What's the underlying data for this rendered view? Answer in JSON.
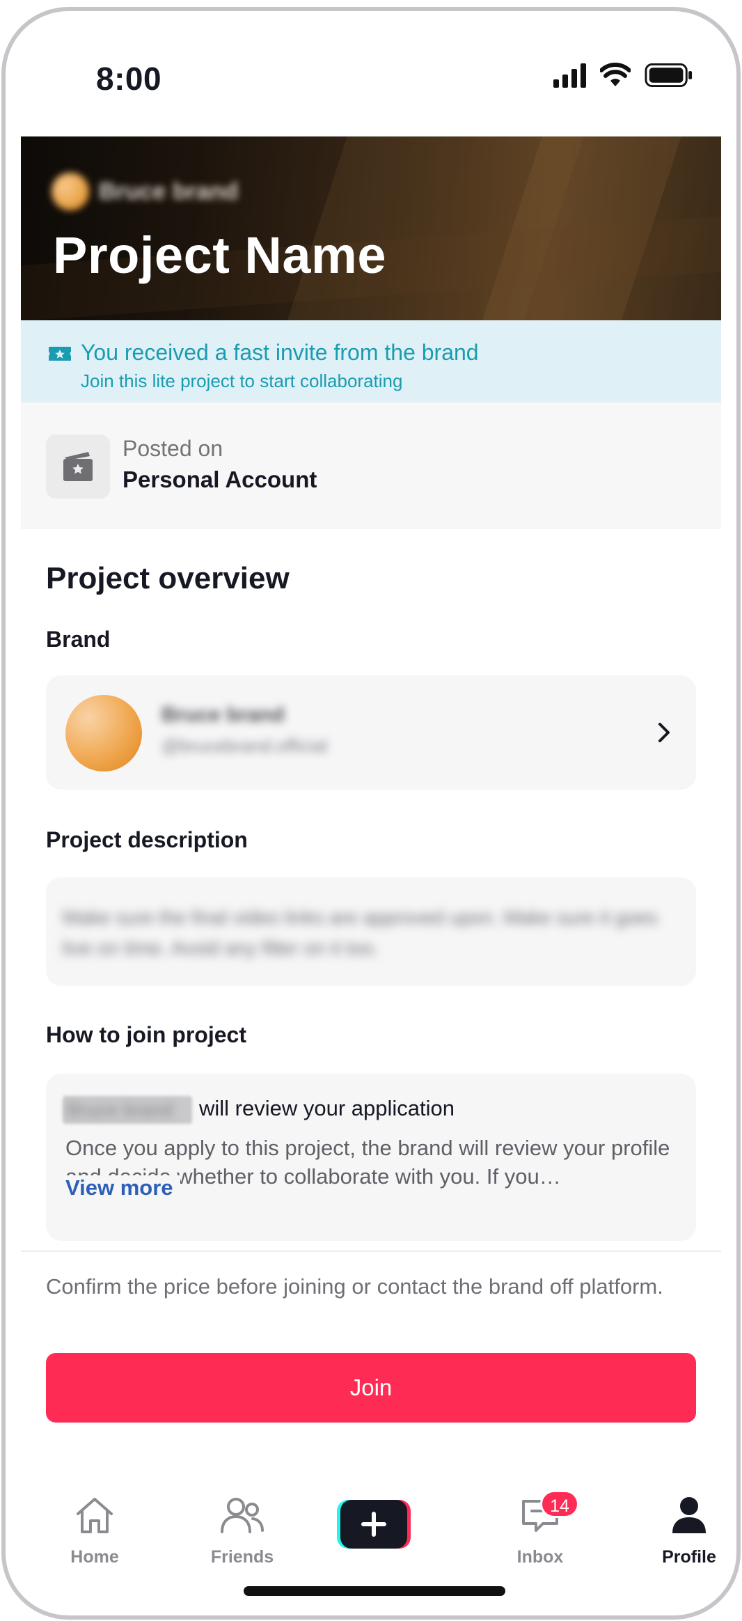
{
  "status_bar": {
    "time": "8:00"
  },
  "header": {
    "brand_name": "Bruce brand",
    "title": "Project Name"
  },
  "invite": {
    "icon": "ticket-icon",
    "title": "You received a fast invite from the brand",
    "subtitle": "Join this lite project to start collaborating",
    "color": "#1a9cb0"
  },
  "posted": {
    "label": "Posted on",
    "account": "Personal Account",
    "icon": "account-card-icon"
  },
  "overview": {
    "heading": "Project overview",
    "brand_heading": "Brand",
    "brand": {
      "name": "Bruce brand",
      "handle": "@brucebrand.official"
    },
    "description_heading": "Project description",
    "description": "Make sure the final video links are approved upon. Make sure it goes live on time. Avoid any filter on it too.",
    "how_to_join_heading": "How to join project",
    "how_to_join": {
      "brand_name": "Bruce brand",
      "title": "will review your application",
      "body": "Once you apply to this project, the brand will review your profile and decide whether to collaborate with you. If you…",
      "view_more": "View more"
    }
  },
  "footer": {
    "confirm_text": "Confirm the price before joining or contact the brand off platform.",
    "join_label": "Join",
    "accent": "#fe2c55"
  },
  "tabbar": {
    "home": "Home",
    "friends": "Friends",
    "inbox": "Inbox",
    "inbox_badge": "14",
    "profile": "Profile"
  }
}
